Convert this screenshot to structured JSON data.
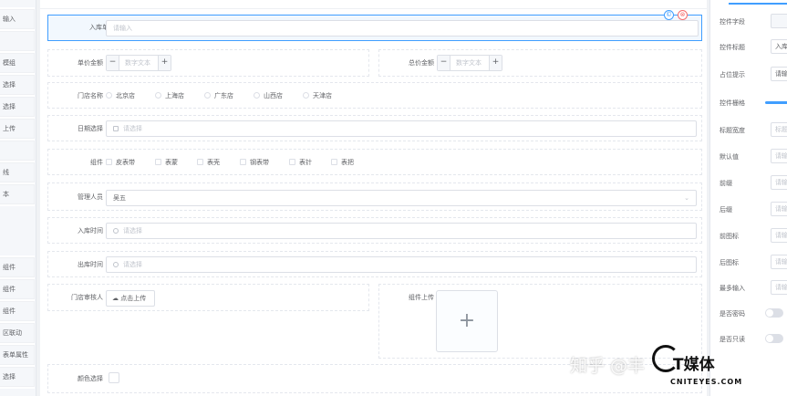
{
  "left_panel": {
    "group1": [
      "输入",
      "",
      "模组",
      "选择",
      "选择",
      "上传",
      "",
      "线",
      "本"
    ],
    "group2": [
      "组件",
      "组件",
      "组件",
      "区联动",
      "表单属性",
      "选择"
    ]
  },
  "form": {
    "row1": {
      "label": "入库单",
      "placeholder": "请输入"
    },
    "row2": {
      "left": {
        "label": "单价金额",
        "placeholder": "数字文本",
        "minus": "−",
        "plus": "+"
      },
      "right": {
        "label": "总价金额",
        "placeholder": "数字文本",
        "minus": "−",
        "plus": "+"
      }
    },
    "row3": {
      "label": "门店名称",
      "options": [
        "北京店",
        "上海店",
        "广东店",
        "山西店",
        "天津店"
      ]
    },
    "row4": {
      "label": "日期选择",
      "placeholder": "请选择"
    },
    "row5": {
      "label": "组件",
      "options": [
        "皮表带",
        "表蒙",
        "表壳",
        "钢表带",
        "表针",
        "表把"
      ]
    },
    "row6": {
      "label": "管理人员",
      "value": "吴五"
    },
    "row7": {
      "label": "入库时间",
      "placeholder": "请选择"
    },
    "row8": {
      "label": "出库时间",
      "placeholder": "请选择"
    },
    "row9": {
      "left": {
        "label": "门店审核人",
        "button": "点击上传"
      },
      "right": {
        "label": "组件上传",
        "plus": "+"
      }
    },
    "row10": {
      "label": "颜色选择"
    }
  },
  "properties": [
    "控件字段",
    "控件标题",
    "占位提示",
    "控件栅格",
    "标题宽度",
    "默认值",
    "前缀",
    "后缀",
    "前图标",
    "后图标",
    "最多输入",
    "是否密码",
    "是否只读"
  ],
  "property_values": {
    "title": "入库",
    "placeholder": "请输",
    "title_width": "标题",
    "default": "请输",
    "prefix": "请输",
    "suffix": "请输",
    "prefix_icon": "请输",
    "suffix_icon": "请输",
    "max": "请输"
  },
  "watermark": {
    "left_text": "知乎 @丰",
    "brand": "T媒体",
    "domain": "CNITEYES.COM"
  },
  "colors": {
    "accent": "#409eff",
    "danger": "#f56c6c"
  }
}
